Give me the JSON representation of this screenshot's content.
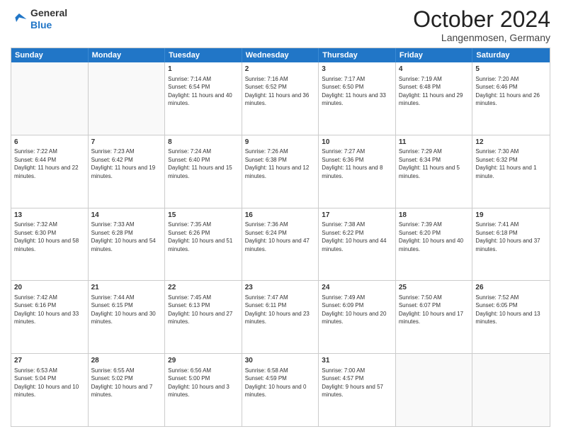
{
  "header": {
    "logo_general": "General",
    "logo_blue": "Blue",
    "month_title": "October 2024",
    "location": "Langenmosen, Germany"
  },
  "days_of_week": [
    "Sunday",
    "Monday",
    "Tuesday",
    "Wednesday",
    "Thursday",
    "Friday",
    "Saturday"
  ],
  "rows": [
    [
      {
        "day": "",
        "sunrise": "",
        "sunset": "",
        "daylight": ""
      },
      {
        "day": "",
        "sunrise": "",
        "sunset": "",
        "daylight": ""
      },
      {
        "day": "1",
        "sunrise": "Sunrise: 7:14 AM",
        "sunset": "Sunset: 6:54 PM",
        "daylight": "Daylight: 11 hours and 40 minutes."
      },
      {
        "day": "2",
        "sunrise": "Sunrise: 7:16 AM",
        "sunset": "Sunset: 6:52 PM",
        "daylight": "Daylight: 11 hours and 36 minutes."
      },
      {
        "day": "3",
        "sunrise": "Sunrise: 7:17 AM",
        "sunset": "Sunset: 6:50 PM",
        "daylight": "Daylight: 11 hours and 33 minutes."
      },
      {
        "day": "4",
        "sunrise": "Sunrise: 7:19 AM",
        "sunset": "Sunset: 6:48 PM",
        "daylight": "Daylight: 11 hours and 29 minutes."
      },
      {
        "day": "5",
        "sunrise": "Sunrise: 7:20 AM",
        "sunset": "Sunset: 6:46 PM",
        "daylight": "Daylight: 11 hours and 26 minutes."
      }
    ],
    [
      {
        "day": "6",
        "sunrise": "Sunrise: 7:22 AM",
        "sunset": "Sunset: 6:44 PM",
        "daylight": "Daylight: 11 hours and 22 minutes."
      },
      {
        "day": "7",
        "sunrise": "Sunrise: 7:23 AM",
        "sunset": "Sunset: 6:42 PM",
        "daylight": "Daylight: 11 hours and 19 minutes."
      },
      {
        "day": "8",
        "sunrise": "Sunrise: 7:24 AM",
        "sunset": "Sunset: 6:40 PM",
        "daylight": "Daylight: 11 hours and 15 minutes."
      },
      {
        "day": "9",
        "sunrise": "Sunrise: 7:26 AM",
        "sunset": "Sunset: 6:38 PM",
        "daylight": "Daylight: 11 hours and 12 minutes."
      },
      {
        "day": "10",
        "sunrise": "Sunrise: 7:27 AM",
        "sunset": "Sunset: 6:36 PM",
        "daylight": "Daylight: 11 hours and 8 minutes."
      },
      {
        "day": "11",
        "sunrise": "Sunrise: 7:29 AM",
        "sunset": "Sunset: 6:34 PM",
        "daylight": "Daylight: 11 hours and 5 minutes."
      },
      {
        "day": "12",
        "sunrise": "Sunrise: 7:30 AM",
        "sunset": "Sunset: 6:32 PM",
        "daylight": "Daylight: 11 hours and 1 minute."
      }
    ],
    [
      {
        "day": "13",
        "sunrise": "Sunrise: 7:32 AM",
        "sunset": "Sunset: 6:30 PM",
        "daylight": "Daylight: 10 hours and 58 minutes."
      },
      {
        "day": "14",
        "sunrise": "Sunrise: 7:33 AM",
        "sunset": "Sunset: 6:28 PM",
        "daylight": "Daylight: 10 hours and 54 minutes."
      },
      {
        "day": "15",
        "sunrise": "Sunrise: 7:35 AM",
        "sunset": "Sunset: 6:26 PM",
        "daylight": "Daylight: 10 hours and 51 minutes."
      },
      {
        "day": "16",
        "sunrise": "Sunrise: 7:36 AM",
        "sunset": "Sunset: 6:24 PM",
        "daylight": "Daylight: 10 hours and 47 minutes."
      },
      {
        "day": "17",
        "sunrise": "Sunrise: 7:38 AM",
        "sunset": "Sunset: 6:22 PM",
        "daylight": "Daylight: 10 hours and 44 minutes."
      },
      {
        "day": "18",
        "sunrise": "Sunrise: 7:39 AM",
        "sunset": "Sunset: 6:20 PM",
        "daylight": "Daylight: 10 hours and 40 minutes."
      },
      {
        "day": "19",
        "sunrise": "Sunrise: 7:41 AM",
        "sunset": "Sunset: 6:18 PM",
        "daylight": "Daylight: 10 hours and 37 minutes."
      }
    ],
    [
      {
        "day": "20",
        "sunrise": "Sunrise: 7:42 AM",
        "sunset": "Sunset: 6:16 PM",
        "daylight": "Daylight: 10 hours and 33 minutes."
      },
      {
        "day": "21",
        "sunrise": "Sunrise: 7:44 AM",
        "sunset": "Sunset: 6:15 PM",
        "daylight": "Daylight: 10 hours and 30 minutes."
      },
      {
        "day": "22",
        "sunrise": "Sunrise: 7:45 AM",
        "sunset": "Sunset: 6:13 PM",
        "daylight": "Daylight: 10 hours and 27 minutes."
      },
      {
        "day": "23",
        "sunrise": "Sunrise: 7:47 AM",
        "sunset": "Sunset: 6:11 PM",
        "daylight": "Daylight: 10 hours and 23 minutes."
      },
      {
        "day": "24",
        "sunrise": "Sunrise: 7:49 AM",
        "sunset": "Sunset: 6:09 PM",
        "daylight": "Daylight: 10 hours and 20 minutes."
      },
      {
        "day": "25",
        "sunrise": "Sunrise: 7:50 AM",
        "sunset": "Sunset: 6:07 PM",
        "daylight": "Daylight: 10 hours and 17 minutes."
      },
      {
        "day": "26",
        "sunrise": "Sunrise: 7:52 AM",
        "sunset": "Sunset: 6:05 PM",
        "daylight": "Daylight: 10 hours and 13 minutes."
      }
    ],
    [
      {
        "day": "27",
        "sunrise": "Sunrise: 6:53 AM",
        "sunset": "Sunset: 5:04 PM",
        "daylight": "Daylight: 10 hours and 10 minutes."
      },
      {
        "day": "28",
        "sunrise": "Sunrise: 6:55 AM",
        "sunset": "Sunset: 5:02 PM",
        "daylight": "Daylight: 10 hours and 7 minutes."
      },
      {
        "day": "29",
        "sunrise": "Sunrise: 6:56 AM",
        "sunset": "Sunset: 5:00 PM",
        "daylight": "Daylight: 10 hours and 3 minutes."
      },
      {
        "day": "30",
        "sunrise": "Sunrise: 6:58 AM",
        "sunset": "Sunset: 4:59 PM",
        "daylight": "Daylight: 10 hours and 0 minutes."
      },
      {
        "day": "31",
        "sunrise": "Sunrise: 7:00 AM",
        "sunset": "Sunset: 4:57 PM",
        "daylight": "Daylight: 9 hours and 57 minutes."
      },
      {
        "day": "",
        "sunrise": "",
        "sunset": "",
        "daylight": ""
      },
      {
        "day": "",
        "sunrise": "",
        "sunset": "",
        "daylight": ""
      }
    ]
  ]
}
